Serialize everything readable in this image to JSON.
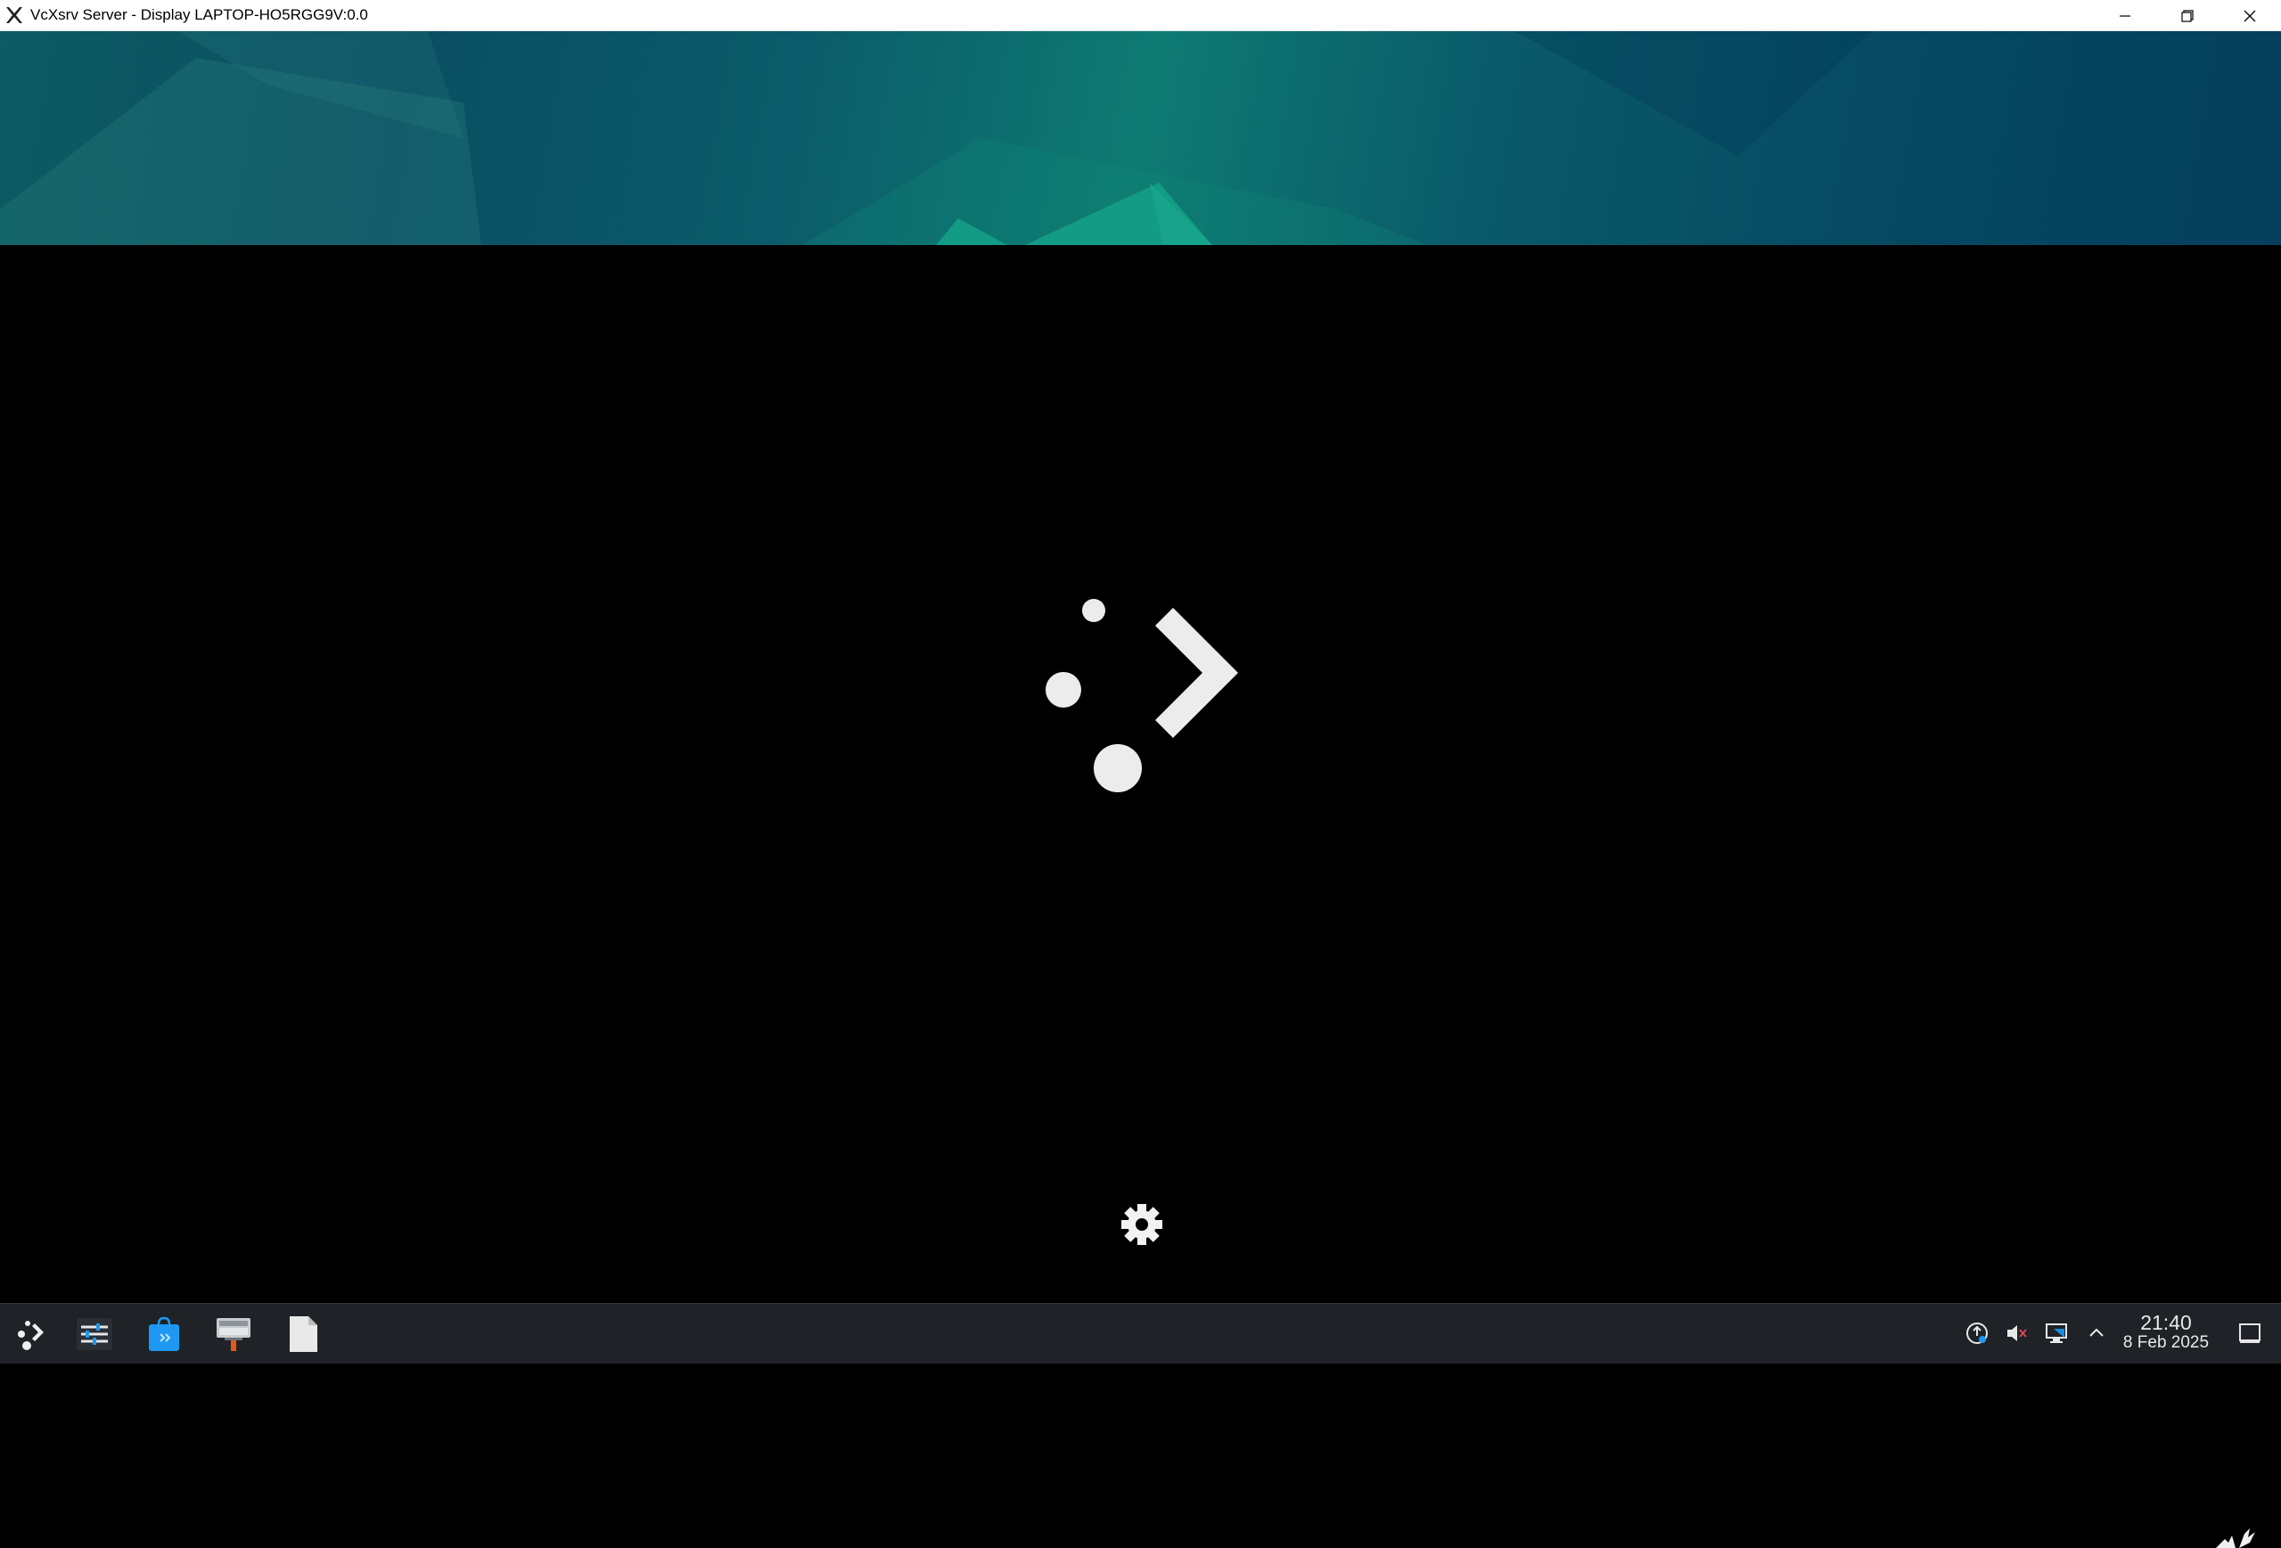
{
  "window": {
    "title": "VcXsrv Server - Display LAPTOP-HO5RGG9V:0.0",
    "controls": [
      "minimize",
      "restore",
      "close"
    ]
  },
  "splash": {
    "logo_icon": "kde-plasma-logo",
    "busy_icon": "gear-icon"
  },
  "taskbar": {
    "launchers": [
      {
        "name": "application-launcher",
        "icon": "plasma-launcher-icon"
      },
      {
        "name": "system-settings",
        "icon": "settings-sliders-icon"
      },
      {
        "name": "discover",
        "icon": "shopping-bag-icon"
      },
      {
        "name": "desktop-pager",
        "icon": "pager-icon"
      },
      {
        "name": "document",
        "icon": "document-icon"
      }
    ],
    "tray": [
      {
        "name": "update-notifier",
        "icon": "update-icon"
      },
      {
        "name": "volume",
        "icon": "volume-muted-icon"
      },
      {
        "name": "network",
        "icon": "network-monitor-icon"
      },
      {
        "name": "show-hidden",
        "icon": "chevron-up-icon"
      }
    ],
    "clock": {
      "time": "21:40",
      "date": "8 Feb 2025"
    },
    "show_desktop_icon": "show-desktop-icon"
  },
  "colors": {
    "taskbar_bg": "#1f2226",
    "accent": "#1d99f3",
    "wallpaper_teal": "#0e7a72"
  }
}
